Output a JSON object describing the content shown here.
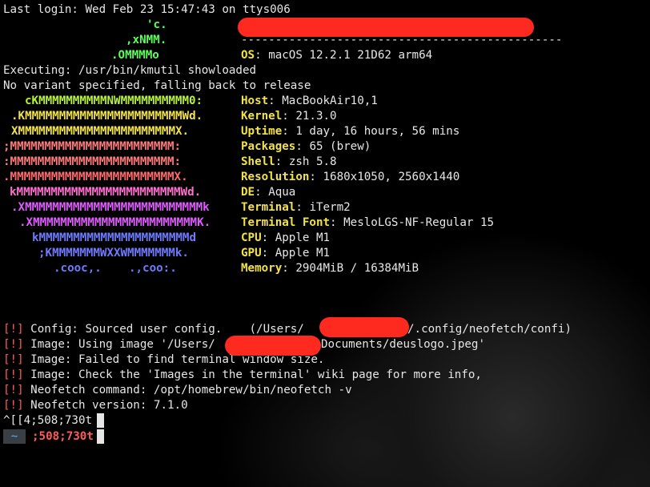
{
  "terminal": {
    "last_login": "Last login: Wed Feb 23 15:47:43 on ttys006",
    "header_underline": "-----------------------------------------------",
    "logo": [
      {
        "text": "'c.",
        "color": "#5cff5c"
      },
      {
        "text": ",xNMM.",
        "color": "#5cff5c"
      },
      {
        "text": ".OMMMMo",
        "color": "#5cff5c"
      },
      {
        "text": "cKMMMMMMMMMMNWMMMMMMMMMM0:",
        "color": "#b9f23b"
      },
      {
        "text": ".KMMMMMMMMMMMMMMMMMMMMMMMWd.",
        "color": "#f2e24a"
      },
      {
        "text": "XMMMMMMMMMMMMMMMMMMMMMMMX.",
        "color": "#f2e24a"
      },
      {
        "text": ";MMMMMMMMMMMMMMMMMMMMMMMM:",
        "color": "#ff7a7a"
      },
      {
        "text": ":MMMMMMMMMMMMMMMMMMMMMMMM:",
        "color": "#ff7a7a"
      },
      {
        "text": ".MMMMMMMMMMMMMMMMMMMMMMMMX.",
        "color": "#ff6b6b"
      },
      {
        "text": "kMMMMMMMMMMMMMMMMMMMMMMMMWd.",
        "color": "#ff6fd0"
      },
      {
        "text": ".XMMMMMMMMMMMMMMMMMMMMMMMMMMk",
        "color": "#e05cff"
      },
      {
        "text": ".XMMMMMMMMMMMMMMMMMMMMMMMMK.",
        "color": "#e05cff"
      },
      {
        "text": "kMMMMMMMMMMMMMMMMMMMMMMd",
        "color": "#6f7bff"
      },
      {
        "text": ";KMMMMMMMWXXWMMMMMMMk.",
        "color": "#6f7bff"
      },
      {
        "text": ".cooc,.    .,coo:.",
        "color": "#6f7bff"
      }
    ],
    "executing": "Executing: /usr/bin/kmutil showloaded",
    "no_variant": "No variant specified, falling back to release",
    "info": [
      {
        "key": "OS",
        "value": "macOS 12.2.1 21D62 arm64"
      },
      {
        "key": "Host",
        "value": "MacBookAir10,1"
      },
      {
        "key": "Kernel",
        "value": "21.3.0"
      },
      {
        "key": "Uptime",
        "value": "1 day, 16 hours, 56 mins"
      },
      {
        "key": "Packages",
        "value": "65 (brew)"
      },
      {
        "key": "Shell",
        "value": "zsh 5.8"
      },
      {
        "key": "Resolution",
        "value": "1680x1050, 2560x1440"
      },
      {
        "key": "DE",
        "value": "Aqua"
      },
      {
        "key": "Terminal",
        "value": "iTerm2"
      },
      {
        "key": "Terminal Font",
        "value": "MesloLGS-NF-Regular 15"
      },
      {
        "key": "CPU",
        "value": "Apple M1"
      },
      {
        "key": "GPU",
        "value": "Apple M1"
      },
      {
        "key": "Memory",
        "value": "2904MiB / 16384MiB"
      }
    ],
    "errors": [
      {
        "tag": "[!]",
        "a": " Config: Sourced user config.    (/Users/",
        "b": "/.config/neofetch/confi)"
      },
      {
        "tag": "[!]",
        "a": " Image: Using image '/Users/",
        "b": "Documents/deuslogo.jpeg'"
      },
      {
        "tag": "[!]",
        "a": " Image: Failed to find terminal window size.",
        "b": ""
      },
      {
        "tag": "[!]",
        "a": " Image: Check the 'Images in the terminal' wiki page for more info,",
        "b": ""
      },
      {
        "tag": "[!]",
        "a": " Neofetch command: /opt/homebrew/bin/neofetch -v",
        "b": ""
      },
      {
        "tag": "[!]",
        "a": " Neofetch version: 7.1.0",
        "b": ""
      }
    ],
    "trail": "^[[4;508;730t",
    "prompt_dir": "~",
    "prompt_text": ";508;730t"
  }
}
